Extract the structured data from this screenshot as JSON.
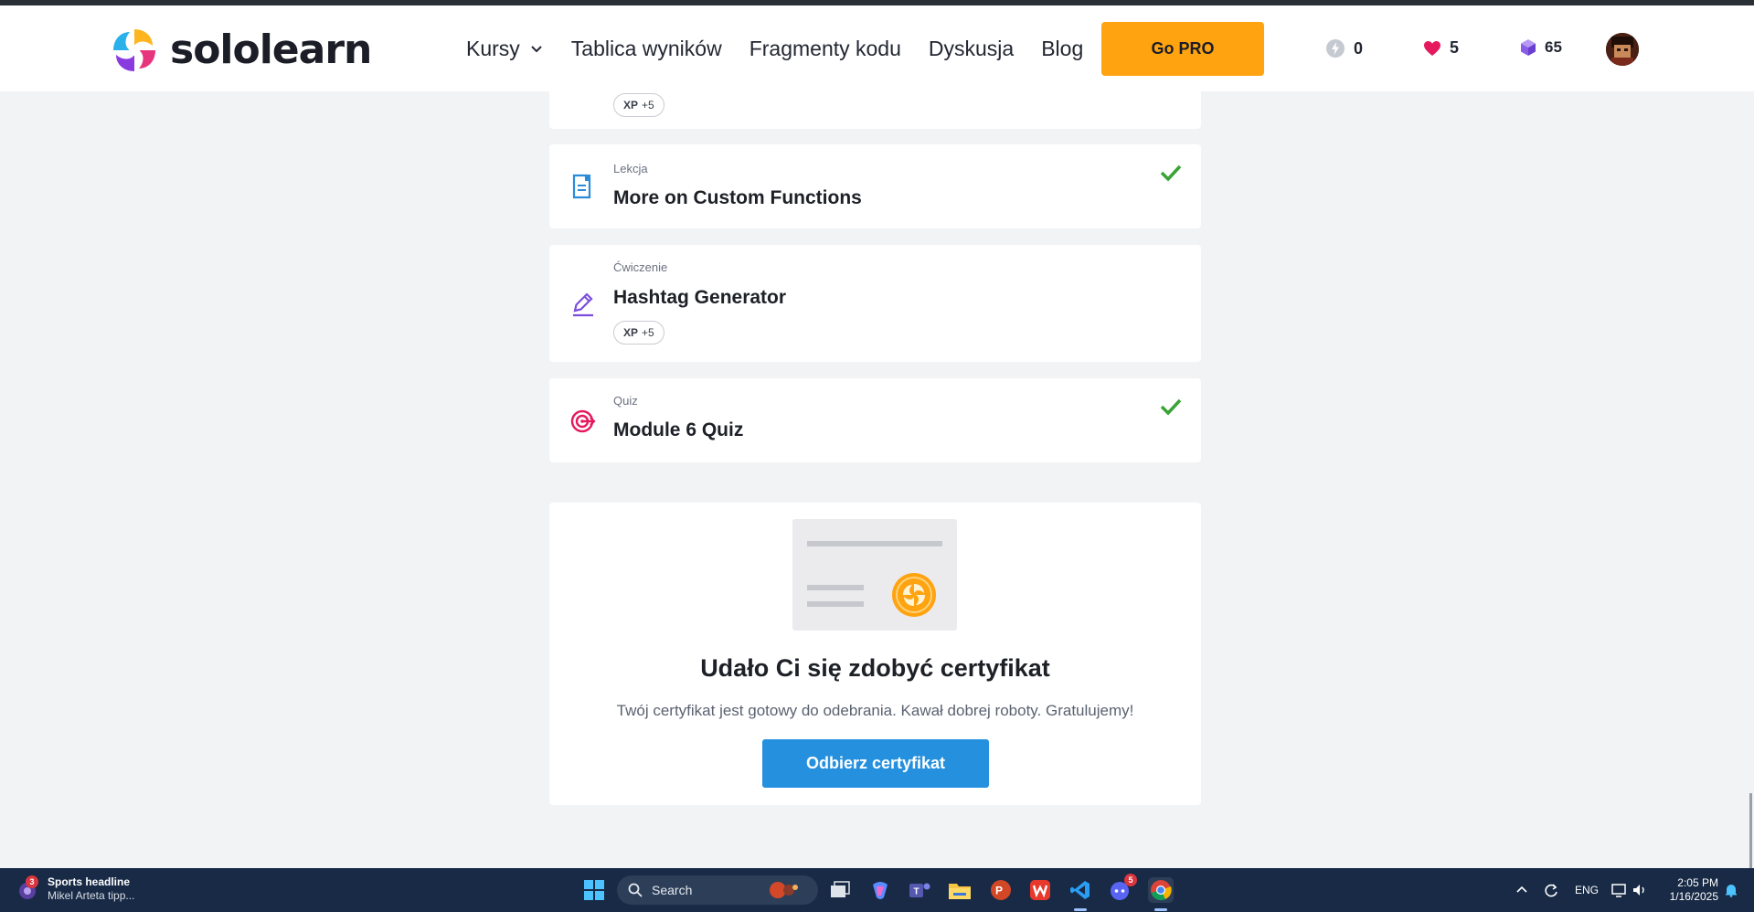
{
  "header": {
    "logo_text": "sololearn",
    "nav": [
      {
        "label": "Kursy",
        "has_dropdown": true
      },
      {
        "label": "Tablica wyników"
      },
      {
        "label": "Fragmenty kodu"
      },
      {
        "label": "Dyskusja"
      },
      {
        "label": "Blog"
      }
    ],
    "go_pro_label": "Go PRO",
    "streak": "0",
    "hearts": "5",
    "gems": "65"
  },
  "items": [
    {
      "xp_label": "XP",
      "xp_value": "+5"
    },
    {
      "type": "Lekcja",
      "title": "More on Custom Functions",
      "completed": true,
      "icon": "lesson-icon"
    },
    {
      "type": "Ćwiczenie",
      "title": "Hashtag Generator",
      "xp_label": "XP",
      "xp_value": "+5",
      "icon": "pencil-icon"
    },
    {
      "type": "Quiz",
      "title": "Module 6 Quiz",
      "completed": true,
      "icon": "target-icon"
    }
  ],
  "certificate": {
    "title": "Udało Ci się zdobyć certyfikat",
    "subtitle": "Twój certyfikat jest gotowy do odebrania. Kawał dobrej roboty. Gratulujemy!",
    "button_label": "Odbierz certyfikat"
  },
  "taskbar": {
    "news_badge": "3",
    "news_title": "Sports headline",
    "news_sub": "Mikel Arteta tipp...",
    "search_placeholder": "Search",
    "discord_badge": "5",
    "language": "ENG",
    "time": "2:05 PM",
    "date": "1/16/2025"
  },
  "colors": {
    "accent_orange": "#ffa310",
    "button_blue": "#2590de",
    "check_green": "#3aa336",
    "lesson_blue": "#2c8bd8",
    "exercise_purple": "#7c4ddd",
    "quiz_pink": "#e5195d"
  }
}
